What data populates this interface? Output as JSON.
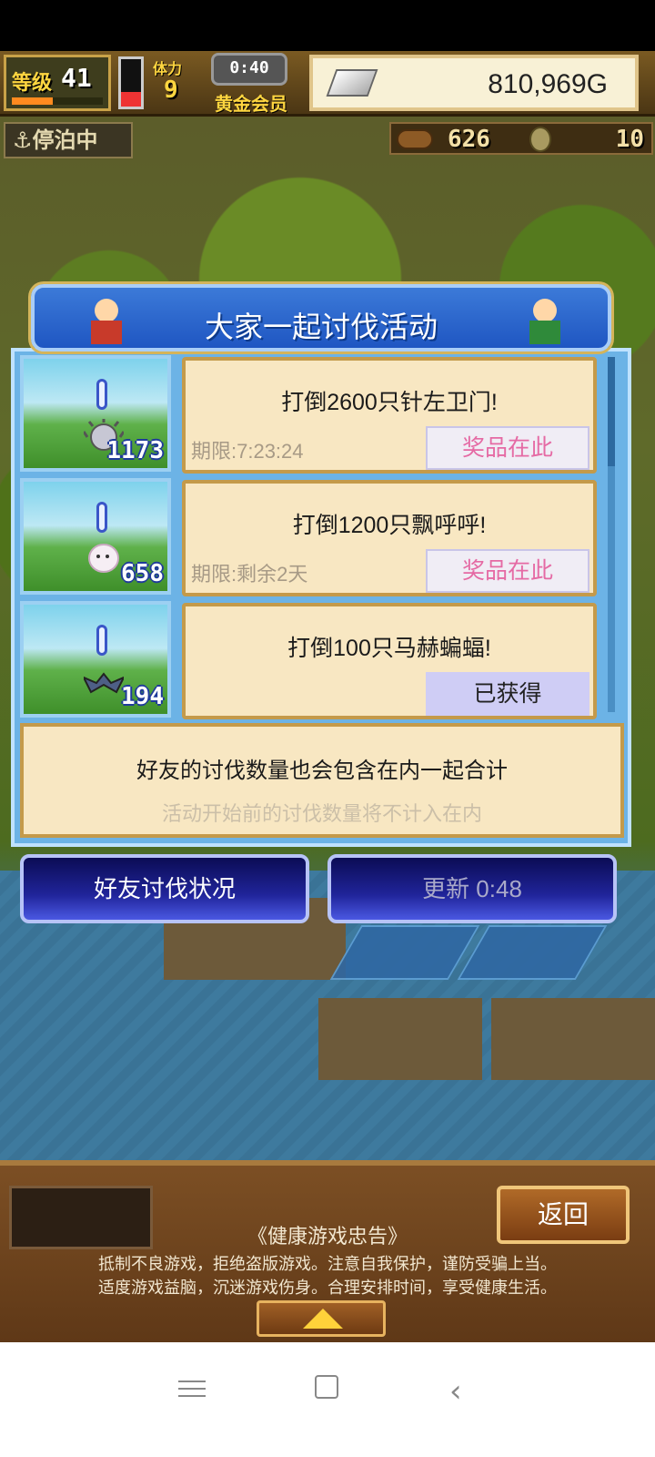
{
  "hud": {
    "level_label": "等级",
    "level_value": "41",
    "level_progress": 0.45,
    "stamina_label": "体力",
    "stamina_value": "9",
    "stamina_level": 0.3,
    "timer": "0:40",
    "vip_label": "黄金会员",
    "gold": "810,969G",
    "anchor_status": "⚓停泊中",
    "wood": "626",
    "coins": "10"
  },
  "event": {
    "title": "大家一起讨伐活动",
    "quests": [
      {
        "title": "打倒2600只针左卫门!",
        "deadline": "期限:7:23:24",
        "button": "奖品在此",
        "count": "1173",
        "monster_icon": "spiky-urchin-icon",
        "status": "claimable"
      },
      {
        "title": "打倒1200只飘呼呼!",
        "deadline": "期限:剩余2天",
        "button": "奖品在此",
        "count": "658",
        "monster_icon": "ghost-icon",
        "status": "claimable"
      },
      {
        "title": "打倒100只马赫蝙蝠!",
        "deadline": "",
        "button": "已获得",
        "count": "194",
        "monster_icon": "bat-icon",
        "status": "obtained"
      }
    ],
    "info_main": "好友的讨伐数量也会包含在内一起合计",
    "info_sub": "活动开始前的讨伐数量将不计入在内"
  },
  "buttons": {
    "friends_status": "好友讨伐状况",
    "refresh": "更新 0:48"
  },
  "bottom": {
    "back": "返回",
    "notice_title": "《健康游戏忠告》",
    "notice_line1": "抵制不良游戏，拒绝盗版游戏。注意自我保护，谨防受骗上当。",
    "notice_line2": "适度游戏益脑，沉迷游戏伤身。合理安排时间，享受健康生活。"
  },
  "colors": {
    "panel_blue": "#6cb3e6",
    "card_bg": "#f8e7c2",
    "prize_text": "#e56aa4",
    "button_dark": "#20249a"
  }
}
